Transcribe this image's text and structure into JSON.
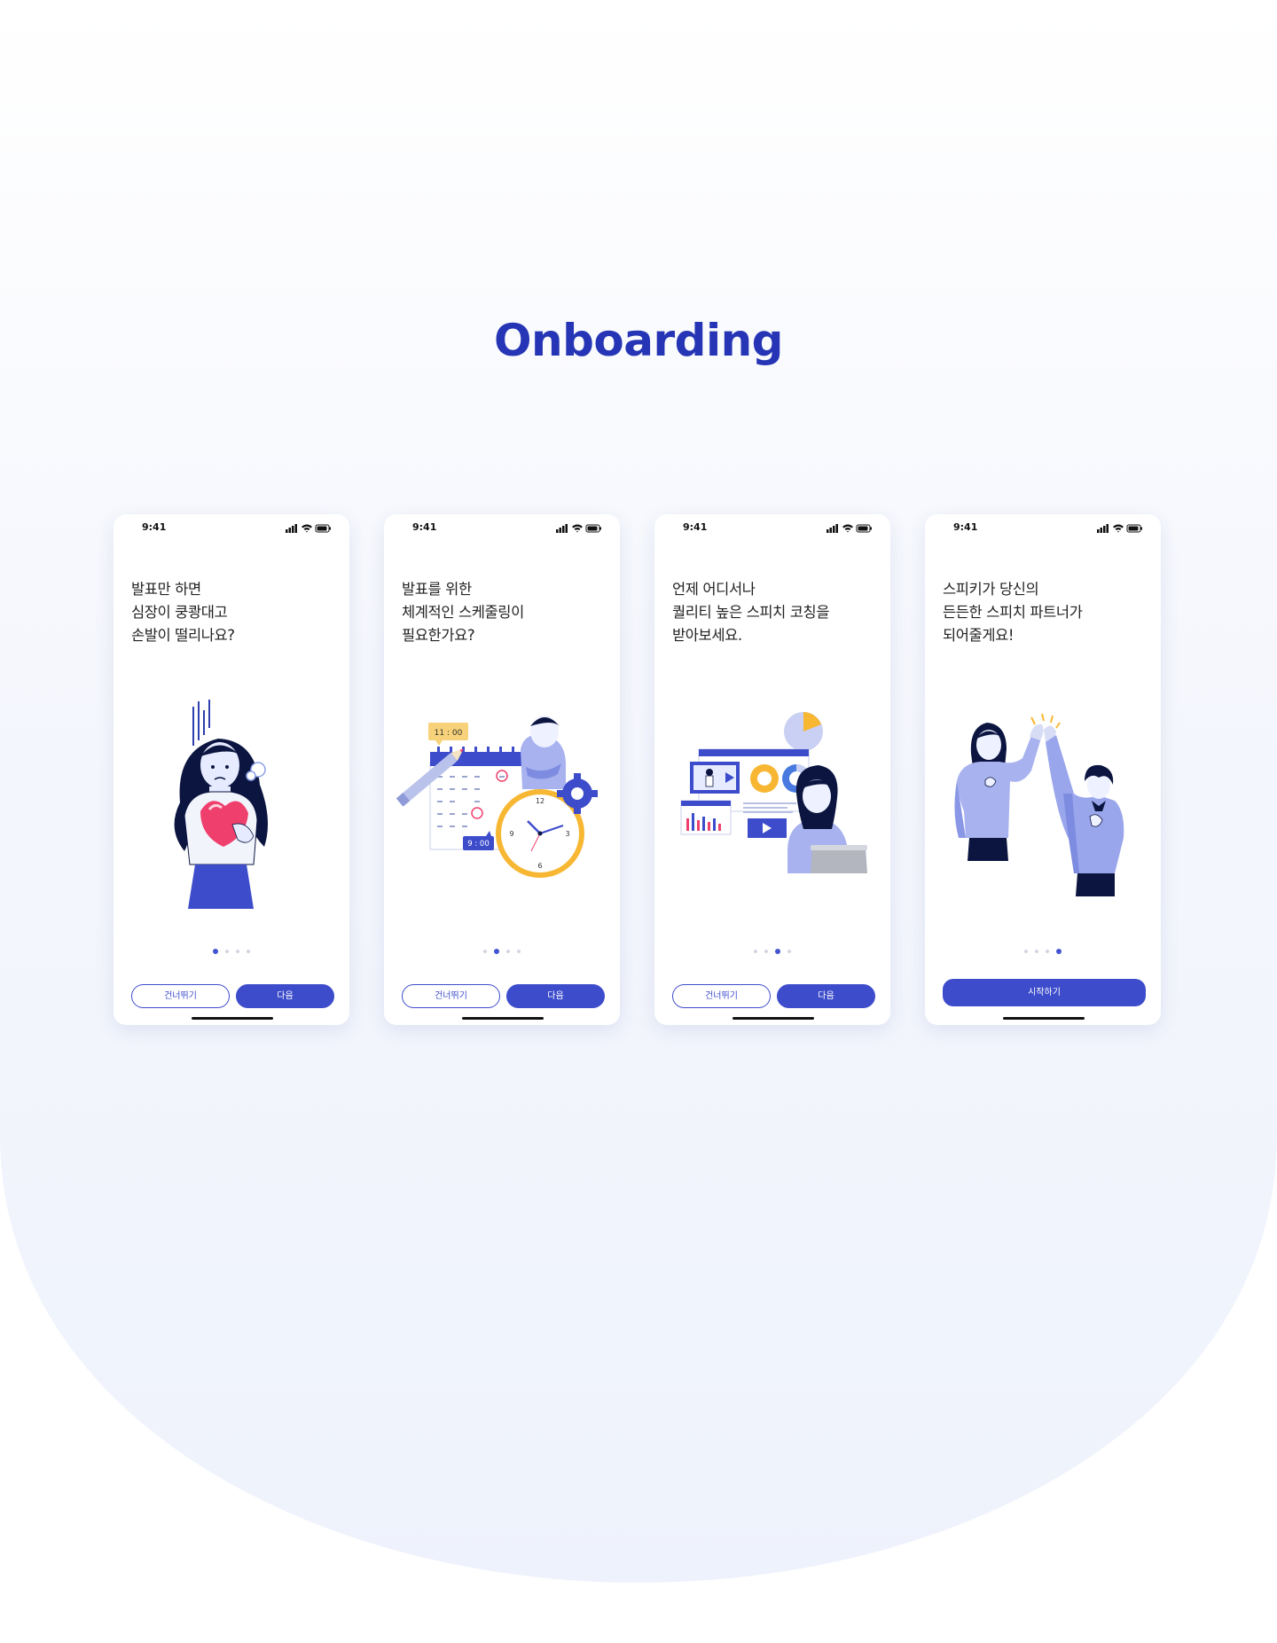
{
  "page": {
    "title": "Onboarding"
  },
  "status_bar": {
    "time": "9:41"
  },
  "screens": [
    {
      "headline": [
        "발표만 하면",
        "심장이 쿵쾅대고",
        "손발이 떨리나요?"
      ],
      "illustration": "nervous-woman-heart",
      "active_dot": 0,
      "buttons": {
        "skip": "건너뛰기",
        "next": "다음"
      }
    },
    {
      "headline": [
        "발표를 위한",
        "체계적인 스케줄링이",
        "필요한가요?"
      ],
      "illustration": "calendar-clock-scheduling",
      "active_dot": 1,
      "buttons": {
        "skip": "건너뛰기",
        "next": "다음"
      },
      "labels": {
        "time_top": "11 : 00",
        "time_bottom": "9 : 00"
      }
    },
    {
      "headline": [
        "언제 어디서나",
        "퀄리티 높은 스피치 코칭을",
        "받아보세요."
      ],
      "illustration": "online-speech-coaching",
      "active_dot": 2,
      "buttons": {
        "skip": "건너뛰기",
        "next": "다음"
      }
    },
    {
      "headline": [
        "스피키가 당신의",
        "든든한 스피치 파트너가",
        "되어줄게요!"
      ],
      "illustration": "high-five-partners",
      "active_dot": 3,
      "buttons": {
        "start": "시작하기"
      }
    }
  ],
  "colors": {
    "brand": "#3d4ccb",
    "title": "#2535b5",
    "dot_inactive": "#d2d6e3",
    "accent_pink": "#ef3f6d",
    "accent_yellow": "#f7b733"
  }
}
